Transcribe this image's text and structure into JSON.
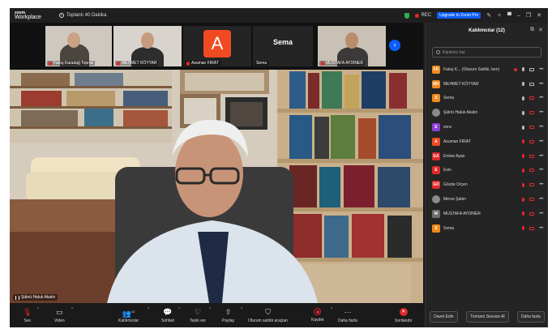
{
  "titlebar": {
    "brand_line1": "zoom",
    "brand_line2": "Workplace",
    "meeting_info": "Toplantı 40 Dakika",
    "rec_label": "REC",
    "upgrade_label": "Upgrade to Zoom Pro"
  },
  "thumbnails": [
    {
      "name": "Fatoş Karadağ Toprak"
    },
    {
      "name": "MEHMET KÖYYAR"
    },
    {
      "name": "Asuman FIRAT",
      "initial": "A"
    },
    {
      "name": "Sema",
      "display": "Sema"
    },
    {
      "name": "MUSTAFA AYDINER"
    }
  ],
  "main_video": {
    "speaker_label": "Şükrü Haluk Akalın"
  },
  "panel": {
    "title": "Katılımcılar (12)",
    "search_placeholder": "Katılımcı bul",
    "participants": [
      {
        "initials": "FK",
        "name": "Fatoş K... (Oturum Sahibi, ben)",
        "color": "#f08a1d"
      },
      {
        "initials": "MK",
        "name": "MEHMET KÖYYAR",
        "color": "#f08a1d"
      },
      {
        "initials": "S",
        "name": "Sema",
        "color": "#f08a1d"
      },
      {
        "initials": "",
        "name": "Şükrü Haluk Akalın",
        "color": "#8a8a8a"
      },
      {
        "initials": "E",
        "name": "esra",
        "color": "#8b3fd9"
      },
      {
        "initials": "A",
        "name": "Asuman FIRAT",
        "color": "#f04a23"
      },
      {
        "initials": "EA",
        "name": "Emine Ayan",
        "color": "#e0282c"
      },
      {
        "initials": "E",
        "name": "Esin",
        "color": "#e0282c"
      },
      {
        "initials": "GO",
        "name": "Gözde Orçen",
        "color": "#e0282c"
      },
      {
        "initials": "",
        "name": "Merve Şahin",
        "color": "#8a8a8a"
      },
      {
        "initials": "M",
        "name": "MUSTAFA AYDINER",
        "color": "#6e6e6e"
      },
      {
        "initials": "S",
        "name": "Sema",
        "color": "#f08a1d"
      }
    ],
    "footer": {
      "invite": "Davet Edin",
      "mute_all": "Tümünü Sessize Al",
      "more": "Daha fazla"
    }
  },
  "toolbar": {
    "audio": "Ses",
    "video": "Video",
    "participants": "Katılımcılar",
    "participants_count": "12",
    "chat": "Sohbet",
    "react": "Tepki ver",
    "share": "Paylaş",
    "host_tools": "Oturum sahibi araçları",
    "record": "Kaydet",
    "more": "Daha fazla",
    "end": "Sonlandır"
  }
}
